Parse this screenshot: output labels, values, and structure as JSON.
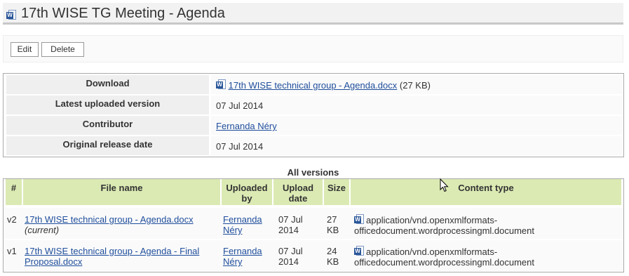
{
  "page": {
    "title": "17th WISE TG Meeting - Agenda",
    "icon": "word-document-icon"
  },
  "toolbar": {
    "edit_label": "Edit",
    "delete_label": "Delete"
  },
  "info": {
    "download_label": "Download",
    "download_link": "17th WISE technical group - Agenda.docx",
    "download_size": "(27 KB)",
    "latest_label": "Latest uploaded version",
    "latest_value": "07 Jul 2014",
    "contributor_label": "Contributor",
    "contributor_value": "Fernanda Néry",
    "release_label": "Original release date",
    "release_value": "07 Jul 2014"
  },
  "versions": {
    "caption": "All versions",
    "headers": {
      "num": "#",
      "file_name": "File name",
      "uploaded_by_1": "Uploaded",
      "uploaded_by_2": "by",
      "upload_date_1": "Upload",
      "upload_date_2": "date",
      "size": "Size",
      "content_type": "Content type"
    },
    "rows": [
      {
        "num": "v2",
        "file_1": "17th WISE technical group - Agenda.docx",
        "file_2": "",
        "note": "(current)",
        "by_1": "Fernanda",
        "by_2": "Néry",
        "date_1": "07 Jul",
        "date_2": "2014",
        "size_1": "27",
        "size_2": "KB",
        "type_1": "application/vnd.openxmlformats-",
        "type_2": "officedocument.wordprocessingml.document"
      },
      {
        "num": "v1",
        "file_1": "17th WISE technical group - Agenda - Final",
        "file_2": "Proposal.docx",
        "note": "",
        "by_1": "Fernanda",
        "by_2": "Néry",
        "date_1": "07 Jul",
        "date_2": "2014",
        "size_1": "24",
        "size_2": "KB",
        "type_1": "application/vnd.openxmlformats-",
        "type_2": "officedocument.wordprocessingml.document"
      }
    ]
  }
}
